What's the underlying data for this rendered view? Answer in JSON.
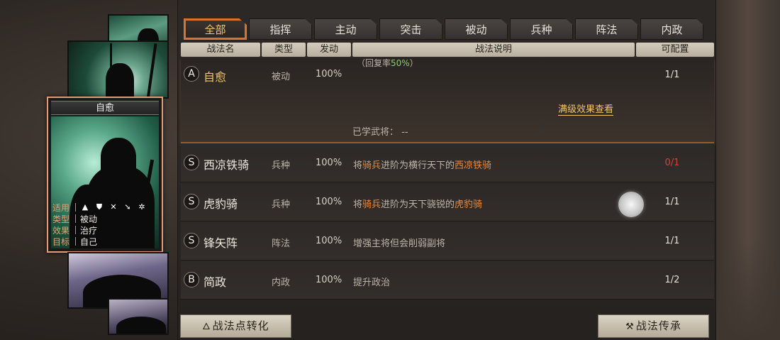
{
  "tabs": [
    {
      "label": "全部",
      "active": true
    },
    {
      "label": "指挥",
      "active": false
    },
    {
      "label": "主动",
      "active": false
    },
    {
      "label": "突击",
      "active": false
    },
    {
      "label": "被动",
      "active": false
    },
    {
      "label": "兵种",
      "active": false
    },
    {
      "label": "阵法",
      "active": false
    },
    {
      "label": "内政",
      "active": false
    }
  ],
  "columns": {
    "name": "战法名",
    "type": "类型",
    "rate": "发动",
    "desc": "战法说明",
    "slot": "可配置"
  },
  "card": {
    "title": "自愈",
    "info": [
      {
        "key": "适用",
        "value": ""
      },
      {
        "key": "类型",
        "value": "被动"
      },
      {
        "key": "效果",
        "value": "治疗"
      },
      {
        "key": "目标",
        "value": "自己"
      }
    ],
    "troop_icons": [
      "cavalry-icon",
      "shield-icon",
      "bow-icon",
      "spear-icon",
      "siege-icon"
    ]
  },
  "expanded": {
    "grade": "A",
    "name": "自愈",
    "type": "被动",
    "rate": "100%",
    "desc_prefix": "（回复率",
    "desc_value": "50%",
    "desc_suffix": "）",
    "slot": "1/1",
    "max_link": "满级效果查看",
    "learned": "已学武将：  --"
  },
  "rows": [
    {
      "grade": "S",
      "name": "西凉铁骑",
      "type": "兵种",
      "rate": "100%",
      "desc": [
        "将",
        "骑兵",
        "进阶为横行天下的",
        "西凉铁骑"
      ],
      "slot": "0/1",
      "slot_red": true
    },
    {
      "grade": "S",
      "name": "虎豹骑",
      "type": "兵种",
      "rate": "100%",
      "desc": [
        "将",
        "骑兵",
        "进阶为天下骁锐的",
        "虎豹骑"
      ],
      "slot": "1/1",
      "slot_red": false
    },
    {
      "grade": "S",
      "name": "锋矢阵",
      "type": "阵法",
      "rate": "100%",
      "desc": [
        "增强主将但会削弱副将"
      ],
      "slot": "1/1",
      "slot_red": false
    },
    {
      "grade": "B",
      "name": "简政",
      "type": "内政",
      "rate": "100%",
      "desc": [
        "提升政治"
      ],
      "slot": "1/2",
      "slot_red": false
    }
  ],
  "buttons": {
    "convert": "战法点转化",
    "inherit": "战法传承"
  }
}
